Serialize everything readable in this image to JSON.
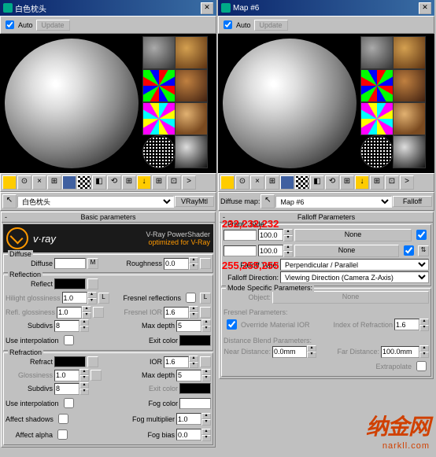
{
  "left": {
    "title": "白色枕头",
    "auto": "Auto",
    "update": "Update",
    "name_field": "白色枕头",
    "type_btn": "VRayMtl",
    "rollup1": "Basic parameters",
    "vray_text": "v·ray",
    "vray_sub1": "V-Ray PowerShader",
    "vray_sub2": "optimized for V-Ray",
    "diffuse": {
      "title": "Diffuse",
      "diffuse_lbl": "Diffuse",
      "roughness_lbl": "Roughness",
      "roughness_val": "0.0",
      "m": "M"
    },
    "reflection": {
      "title": "Reflection",
      "reflect_lbl": "Reflect",
      "hilight_lbl": "Hilight glossiness",
      "hilight_val": "1.0",
      "l": "L",
      "fresnel_lbl": "Fresnel reflections",
      "refl_gloss_lbl": "Refl. glossiness",
      "refl_gloss_val": "1.0",
      "fresnel_ior_lbl": "Fresnel IOR",
      "fresnel_ior_val": "1.6",
      "subdivs_lbl": "Subdivs",
      "subdivs_val": "8",
      "maxdepth_lbl": "Max depth",
      "maxdepth_val": "5",
      "interp_lbl": "Use interpolation",
      "exit_lbl": "Exit color"
    },
    "refraction": {
      "title": "Refraction",
      "refract_lbl": "Refract",
      "ior_lbl": "IOR",
      "ior_val": "1.6",
      "gloss_lbl": "Glossiness",
      "gloss_val": "1.0",
      "maxdepth_lbl": "Max depth",
      "maxdepth_val": "5",
      "subdivs_lbl": "Subdivs",
      "subdivs_val": "8",
      "exit_lbl": "Exit color",
      "interp_lbl": "Use interpolation",
      "fog_color_lbl": "Fog color",
      "shadows_lbl": "Affect shadows",
      "fog_mult_lbl": "Fog multiplier",
      "fog_mult_val": "1.0",
      "alpha_lbl": "Affect alpha",
      "fog_bias_lbl": "Fog bias",
      "fog_bias_val": "0.0"
    }
  },
  "right": {
    "title": "Map #6",
    "auto": "Auto",
    "update": "Update",
    "diffuse_map_lbl": "Diffuse map:",
    "name_field": "Map #6",
    "type_btn": "Falloff",
    "rollup1": "Falloff Parameters",
    "front_side": "Front : Side",
    "val1": "100.0",
    "none": "None",
    "val2": "100.0",
    "ftype_lbl": "Falloff Type:",
    "ftype_val": "Perpendicular / Parallel",
    "fdir_lbl": "Falloff Direction:",
    "fdir_val": "Viewing Direction (Camera Z-Axis)",
    "mode_grp": "Mode Specific Parameters:",
    "object_lbl": "Object:",
    "object_btn": "None",
    "fresnel_grp": "Fresnel Parameters:",
    "override_lbl": "Override Material IOR",
    "ior2_lbl": "Index of Refraction",
    "ior2_val": "1.6",
    "dist_grp": "Distance Blend Parameters:",
    "near_lbl": "Near Distance:",
    "near_val": "0.0mm",
    "far_lbl": "Far Distance:",
    "far_val": "100.0mm",
    "extrap_lbl": "Extrapolate"
  },
  "annot1": "232,232,232",
  "annot2": "255,255,255",
  "wm_text": "纳金网",
  "wm_url": "narkll.com"
}
